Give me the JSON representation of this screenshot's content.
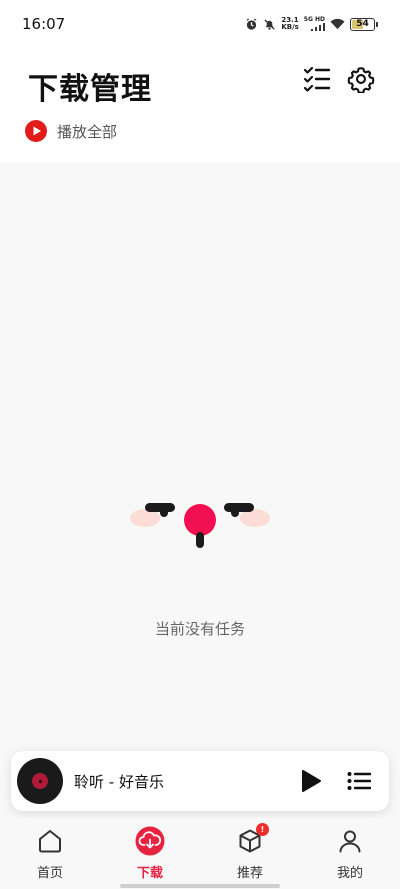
{
  "status_bar": {
    "time": "16:07",
    "speed_value": "23.1",
    "speed_unit": "KB/s",
    "network": "5G HD",
    "battery": "54",
    "battery_level": 0.54
  },
  "header": {
    "title": "下载管理",
    "play_all_label": "播放全部"
  },
  "icons": {
    "edit_list": "checklist-icon",
    "settings": "gear-icon",
    "play_all": "play-circle-icon"
  },
  "empty_state": {
    "message": "当前没有任务"
  },
  "mini_player": {
    "title": "聆听 - 好音乐"
  },
  "bottom_nav": {
    "items": [
      {
        "label": "首页",
        "icon": "home-icon",
        "active": false
      },
      {
        "label": "下载",
        "icon": "cloud-download-icon",
        "active": true
      },
      {
        "label": "推荐",
        "icon": "cube-icon",
        "active": false,
        "badge": "!"
      },
      {
        "label": "我的",
        "icon": "person-icon",
        "active": false
      }
    ]
  },
  "colors": {
    "accent": "#e8233f",
    "play_red": "#e21b1b",
    "face_nose": "#f0104f",
    "background": "#f8f8f8"
  }
}
